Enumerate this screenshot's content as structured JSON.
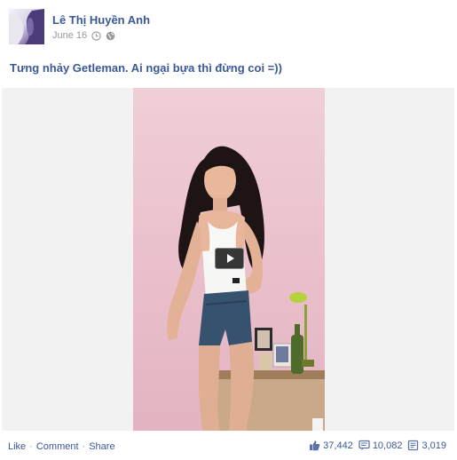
{
  "post": {
    "author": "Lê Thị Huyền Anh",
    "date": "June 16",
    "caption": "Tưng nhảy Getleman. Ai ngại bựa thì đừng coi =))"
  },
  "icons": {
    "clock": "clock-icon",
    "privacy": "globe-icon",
    "play": "play-icon",
    "like": "thumbs-up-icon",
    "comment": "comment-bubble-icon",
    "share": "share-icon"
  },
  "actions": {
    "like": "Like",
    "comment": "Comment",
    "share": "Share",
    "separator": "·"
  },
  "stats": {
    "likes": "37,442",
    "comments": "10,082",
    "shares": "3,019"
  },
  "colors": {
    "link": "#3b5998",
    "muted": "#999999",
    "media_bg": "#f2f2f2",
    "video_wall": "#ecc5cf"
  }
}
